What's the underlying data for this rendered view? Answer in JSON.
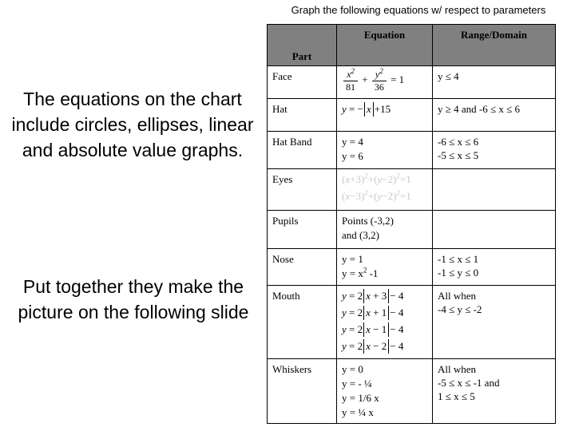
{
  "slide": {
    "title": "Graph the following equations w/ respect to parameters",
    "narrative_1": "The equations on the chart include circles, ellipses, linear and absolute value graphs.",
    "narrative_2": "Put together they make the picture on the following slide"
  },
  "table": {
    "headers": {
      "part": "Part",
      "equation": "Equation",
      "range": "Range/Domain"
    },
    "header_bg": "#808080",
    "rows": [
      {
        "part": "Face",
        "equation_kind": "math",
        "equation_text": "x²/81 + y²/36 = 1",
        "range": [
          "y ≤ 4"
        ]
      },
      {
        "part": "Hat",
        "equation_kind": "math",
        "equation_text": "y = -|x| + 15",
        "range": [
          "y ≥ 4  and  -6 ≤ x ≤ 6"
        ]
      },
      {
        "part": "Hat Band",
        "equation_kind": "plain",
        "equations": [
          "y = 4",
          "y = 6"
        ],
        "range": [
          "-6 ≤ x ≤ 6",
          "-5 ≤ x ≤ 5"
        ]
      },
      {
        "part": "Eyes",
        "equation_kind": "math-faint",
        "equations": [
          "(x+3)² + (y-2)² = 1",
          "(x-3)² + (y-2)² = 1"
        ],
        "range": []
      },
      {
        "part": "Pupils",
        "equation_kind": "plain",
        "equations": [
          "Points (-3,2)",
          "and (3,2)"
        ],
        "range": []
      },
      {
        "part": "Nose",
        "equation_kind": "plain",
        "equations": [
          "y = 1",
          "y = x² -1"
        ],
        "range": [
          "-1 ≤ x ≤ 1",
          "-1 ≤ y ≤ 0"
        ]
      },
      {
        "part": "Mouth",
        "equation_kind": "math",
        "equations": [
          "y = 2|x + 3| - 4",
          "y = 2|x + 1| - 4",
          "y = 2|x - 1| - 4",
          "y = 2|x - 2| - 4"
        ],
        "range": [
          "All when",
          "-4 ≤ y ≤ -2"
        ]
      },
      {
        "part": "Whiskers",
        "equation_kind": "plain",
        "equations": [
          "y = 0",
          "y = - ¼",
          "y = 1/6 x",
          "y = ¼ x"
        ],
        "range": [
          "All when",
          "-5 ≤ x ≤ -1  and",
          "1 ≤ x ≤ 5"
        ]
      }
    ]
  }
}
